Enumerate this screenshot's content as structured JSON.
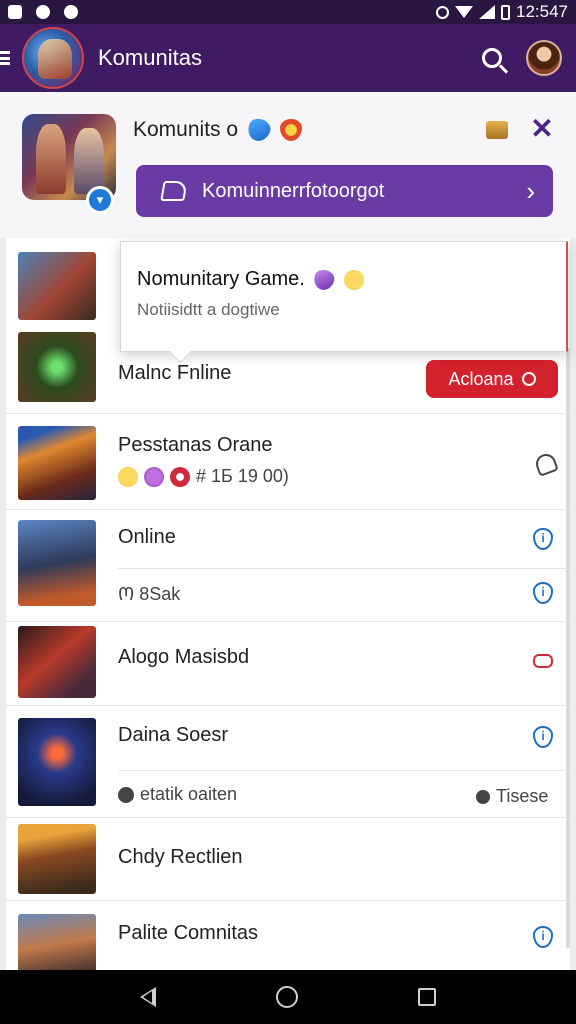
{
  "status_bar": {
    "time": "12:547"
  },
  "app_bar": {
    "title": "Komunitas"
  },
  "header": {
    "title": "Komunits o",
    "join_button_label": "Komuinnerrfotoorgot"
  },
  "tooltip": {
    "title": "Nomunitary Game.",
    "subtitle": "Notiisidtt a dogtiwe"
  },
  "rows": [
    {
      "title": "Malnc Fnline",
      "action_label": "Acloana"
    },
    {
      "title": "Pesstanas Orane",
      "meta": "# 1Б 19 00)"
    },
    {
      "title": "Online",
      "sub": "Ო 8Sak"
    },
    {
      "title": "Alogo Masisbd"
    },
    {
      "title": "Daina Soesr",
      "sub": "etatik oaiten",
      "right_label": "Tisese"
    },
    {
      "title": "Chdy Rectlien"
    },
    {
      "title": "Palite Comnitas"
    }
  ],
  "colors": {
    "status_bar": "#2a1640",
    "app_bar": "#3e1b63",
    "join_button": "#6a3aa5",
    "action_button": "#d3222e",
    "shield_blue": "#1d6fc5"
  },
  "icons": [
    "menu-icon",
    "search-icon",
    "share-icon",
    "chevron-right-icon",
    "close-icon",
    "shield-icon",
    "bell-icon",
    "back-icon",
    "home-icon",
    "recents-icon"
  ]
}
